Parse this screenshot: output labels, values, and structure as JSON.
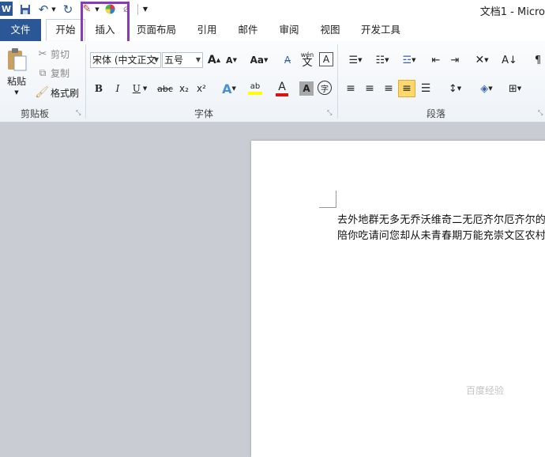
{
  "title_bar": {
    "app_icon": "W",
    "window_title": "文档1 - Micro",
    "qat": {
      "save_icon": "save-icon",
      "undo_icon": "undo-icon",
      "redo_icon": "redo-icon",
      "customize_icon": "chevron-down-icon"
    }
  },
  "tabs": [
    {
      "label": "文件"
    },
    {
      "label": "开始"
    },
    {
      "label": "插入"
    },
    {
      "label": "页面布局"
    },
    {
      "label": "引用"
    },
    {
      "label": "邮件"
    },
    {
      "label": "审阅"
    },
    {
      "label": "视图"
    },
    {
      "label": "开发工具"
    }
  ],
  "ribbon": {
    "clipboard": {
      "label": "剪贴板",
      "paste": "粘贴",
      "cut": "剪切",
      "copy": "复制",
      "format_painter": "格式刷"
    },
    "font": {
      "label": "字体",
      "font_name": "宋体 (中文正文",
      "font_size": "五号",
      "grow": "A",
      "shrink": "A",
      "change_case": "Aa",
      "bold": "B",
      "italic": "I",
      "underline": "U",
      "strike": "abc",
      "subscript": "x₂",
      "superscript": "x²",
      "highlight": "ab",
      "font_color": "A",
      "char_shade": "A",
      "enclose": "字",
      "pinyin": "wén",
      "pinyin_char": "文"
    },
    "paragraph": {
      "label": "段落"
    },
    "colors": {
      "file_tab": "#2b5797",
      "highlight_box": "#8a3ab9",
      "font_color_bar": "#e01010",
      "highlight_bar": "#ffff00"
    }
  },
  "document": {
    "lines": [
      "去外地群无多无乔沃维奇二无厄齐尔厄齐尔的撒",
      "陪你吃请问您却从未青春期万能充崇文区农村从"
    ]
  },
  "watermark": "百度经验"
}
